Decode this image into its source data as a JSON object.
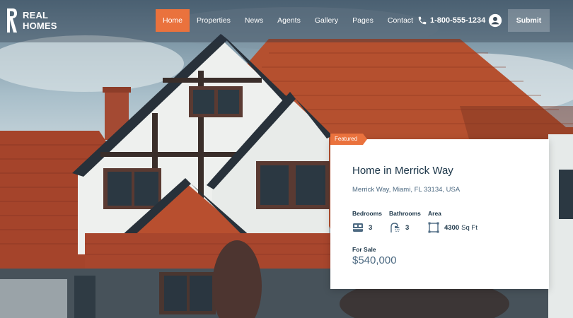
{
  "brand": {
    "logo_line1": "REAL",
    "logo_line2": "HOMES"
  },
  "nav": {
    "items": [
      {
        "label": "Home",
        "active": true
      },
      {
        "label": "Properties",
        "active": false
      },
      {
        "label": "News",
        "active": false
      },
      {
        "label": "Agents",
        "active": false
      },
      {
        "label": "Gallery",
        "active": false
      },
      {
        "label": "Pages",
        "active": false
      },
      {
        "label": "Contact",
        "active": false
      }
    ],
    "phone": "1-800-555-1234",
    "phone_icon": "phone-icon",
    "user_icon": "user-circle-icon",
    "submit_label": "Submit"
  },
  "property": {
    "badge": "Featured",
    "title": "Home in Merrick Way",
    "address": "Merrick Way, Miami, FL 33134, USA",
    "bedrooms_label": "Bedrooms",
    "bedrooms_value": "3",
    "bathrooms_label": "Bathrooms",
    "bathrooms_value": "3",
    "area_label": "Area",
    "area_value": "4300",
    "area_unit": "Sq Ft",
    "status": "For Sale",
    "price": "$540,000"
  },
  "colors": {
    "accent": "#ea723d",
    "title": "#1a3447",
    "muted": "#4d6a82"
  }
}
